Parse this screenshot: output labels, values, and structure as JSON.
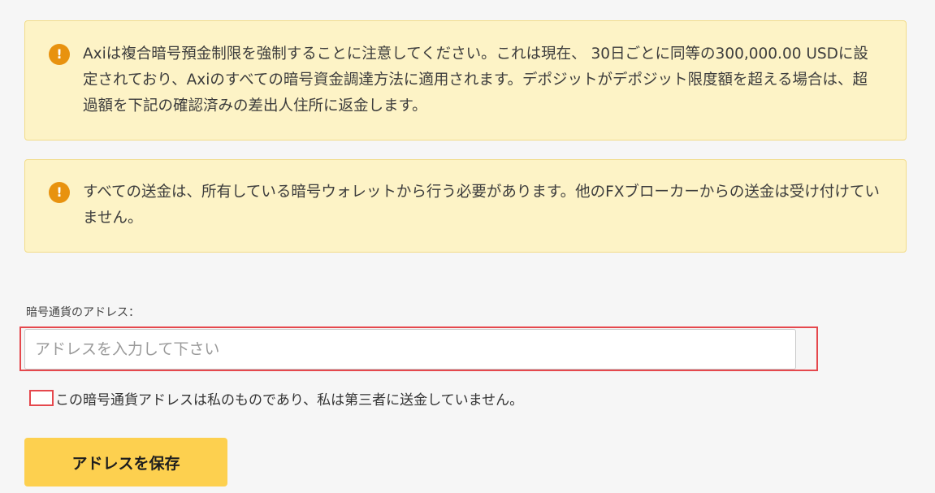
{
  "notices": [
    {
      "icon": "info-icon",
      "text": "Axiは複合暗号預金制限を強制することに注意してください。これは現在、 30日ごとに同等の300,000.00 USDに設定されており、Axiのすべての暗号資金調達方法に適用されます。デポジットがデポジット限度額を超える場合は、超過額を下記の確認済みの差出人住所に返金します。"
    },
    {
      "icon": "info-icon",
      "text": "すべての送金は、所有している暗号ウォレットから行う必要があります。他のFXブローカーからの送金は受け付けていません。"
    }
  ],
  "address": {
    "label": "暗号通貨のアドレス：",
    "placeholder": "アドレスを入力して下さい",
    "value": ""
  },
  "confirmation": {
    "checked": false,
    "label": "この暗号通貨アドレスは私のものであり、私は第三者に送金していません。"
  },
  "save_button": {
    "label": "アドレスを保存"
  },
  "colors": {
    "notice_background": "#fdf3c6",
    "notice_border": "#f2dc8a",
    "info_icon": "#e8920f",
    "button_background": "#fdd04f",
    "highlight_border": "#e5484d"
  }
}
